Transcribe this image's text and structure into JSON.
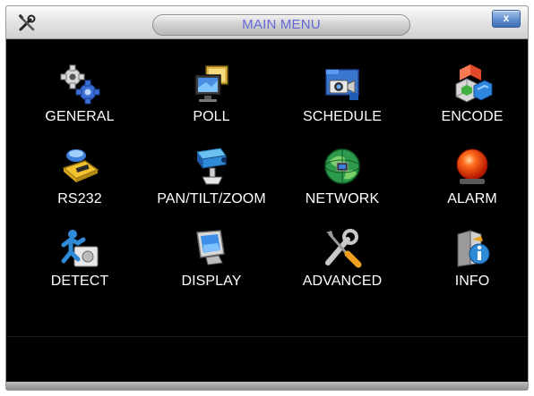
{
  "window": {
    "title": "MAIN MENU",
    "close_label": "x"
  },
  "menu": {
    "items": [
      {
        "label": "GENERAL",
        "icon": "gears-icon"
      },
      {
        "label": "POLL",
        "icon": "monitors-icon"
      },
      {
        "label": "SCHEDULE",
        "icon": "camera-folder-icon"
      },
      {
        "label": "ENCODE",
        "icon": "blocks-icon"
      },
      {
        "label": "RS232",
        "icon": "serial-port-icon"
      },
      {
        "label": "PAN/TILT/ZOOM",
        "icon": "ptz-camera-icon"
      },
      {
        "label": "NETWORK",
        "icon": "globe-network-icon"
      },
      {
        "label": "ALARM",
        "icon": "alarm-light-icon"
      },
      {
        "label": "DETECT",
        "icon": "motion-figure-icon"
      },
      {
        "label": "DISPLAY",
        "icon": "crt-monitor-icon"
      },
      {
        "label": "ADVANCED",
        "icon": "wrench-screwdriver-icon"
      },
      {
        "label": "INFO",
        "icon": "info-icon"
      }
    ]
  },
  "colors": {
    "title_text": "#6468d6",
    "background": "#000000",
    "label_text": "#ffffff"
  }
}
